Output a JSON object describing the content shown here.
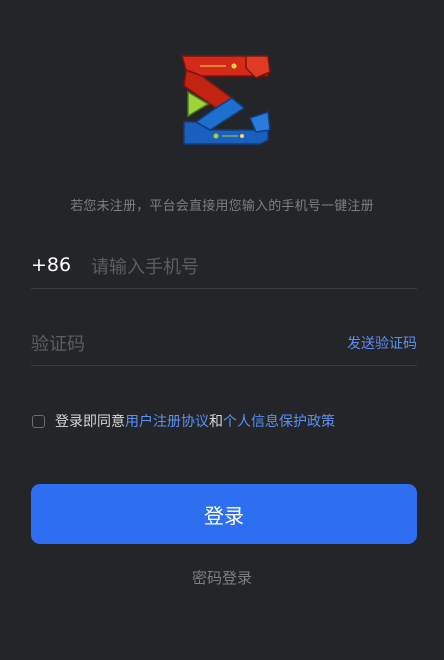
{
  "hint": "若您未注册，平台会直接用您输入的手机号一键注册",
  "phone": {
    "country_code": "+86",
    "placeholder": "请输入手机号",
    "value": ""
  },
  "code": {
    "placeholder": "验证码",
    "value": "",
    "send_label": "发送验证码"
  },
  "agreement": {
    "checked": false,
    "prefix": "登录即同意",
    "user_agreement": "用户注册协议",
    "conjunction": "和",
    "privacy_policy": "个人信息保护政策"
  },
  "login_button": "登录",
  "password_login": "密码登录",
  "colors": {
    "background": "#242528",
    "primary": "#2e6ff2",
    "link": "#5b8ff2",
    "logo_red": "#d42a1a",
    "logo_blue": "#1f6fd0",
    "logo_green": "#9ed43a"
  }
}
